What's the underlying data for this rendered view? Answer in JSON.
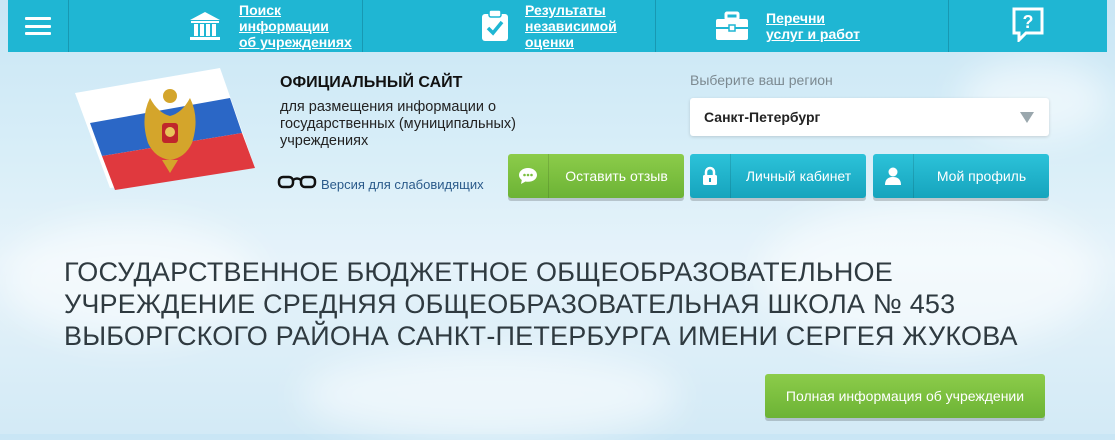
{
  "topnav": {
    "items": [
      {
        "label_line1": "Поиск информации",
        "label_line2": "об учреждениях",
        "icon": "building-icon"
      },
      {
        "label_line1": "Результаты",
        "label_line2": "независимой оценки",
        "icon": "clipboard-check-icon"
      },
      {
        "label_line1": "Перечни",
        "label_line2": "услуг и работ",
        "icon": "briefcase-icon"
      }
    ],
    "help_icon": "question-icon"
  },
  "header": {
    "site_title": "ОФИЦИАЛЬНЫЙ САЙТ",
    "site_desc": "для размещения информации о государственных (муниципальных) учреждениях",
    "impaired_link": "Версия для слабовидящих"
  },
  "region": {
    "label": "Выберите ваш регион",
    "selected": "Санкт-Петербург"
  },
  "buttons": {
    "feedback": "Оставить отзыв",
    "cabinet": "Личный кабинет",
    "profile": "Мой профиль",
    "full_info": "Полная информация об учреждении"
  },
  "organization": {
    "name": "ГОСУДАРСТВЕННОЕ БЮДЖЕТНОЕ ОБЩЕОБРАЗОВАТЕЛЬНОЕ УЧРЕЖДЕНИЕ СРЕДНЯЯ ОБЩЕОБРАЗОВАТЕЛЬНАЯ ШКОЛА № 453 ВЫБОРГСКОГО РАЙОНА САНКТ-ПЕТЕРБУРГА ИМЕНИ СЕРГЕЯ ЖУКОВА"
  },
  "colors": {
    "nav_bg": "#1fb6d3",
    "green_button": "#7bbf3f",
    "teal_button": "#1fb6d3",
    "flag_white": "#ffffff",
    "flag_blue": "#2b67c6",
    "flag_red": "#e0393e"
  }
}
